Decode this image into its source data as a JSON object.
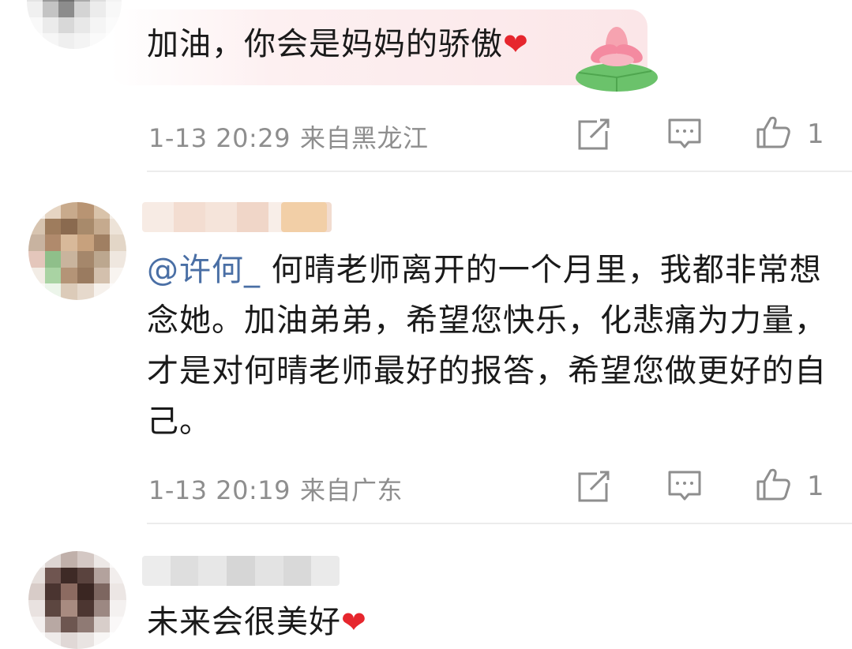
{
  "comments": [
    {
      "text": "加油，你会是妈妈的骄傲",
      "emoji": "❤",
      "time": "1-13 20:29",
      "location": "来自黑龙江",
      "likes": "1",
      "has_lotus": true
    },
    {
      "mention": "@许何_",
      "text": " 何晴老师离开的一个月里，我都非常想念她。加油弟弟，希望您快乐，化悲痛为力量，才是对何晴老师最好的报答，希望您做更好的自己。",
      "time": "1-13 20:19",
      "location": "来自广东",
      "likes": "1"
    },
    {
      "text": "未来会很美好",
      "emoji": "❤"
    }
  ],
  "icons": {
    "share": "share-icon",
    "comment": "comment-icon",
    "like": "thumbs-up-icon",
    "heart": "heart-icon",
    "lotus": "lotus-icon"
  },
  "colors": {
    "mention": "#4a6fa5",
    "meta": "#8e8e8e",
    "heart": "#e6262d"
  }
}
